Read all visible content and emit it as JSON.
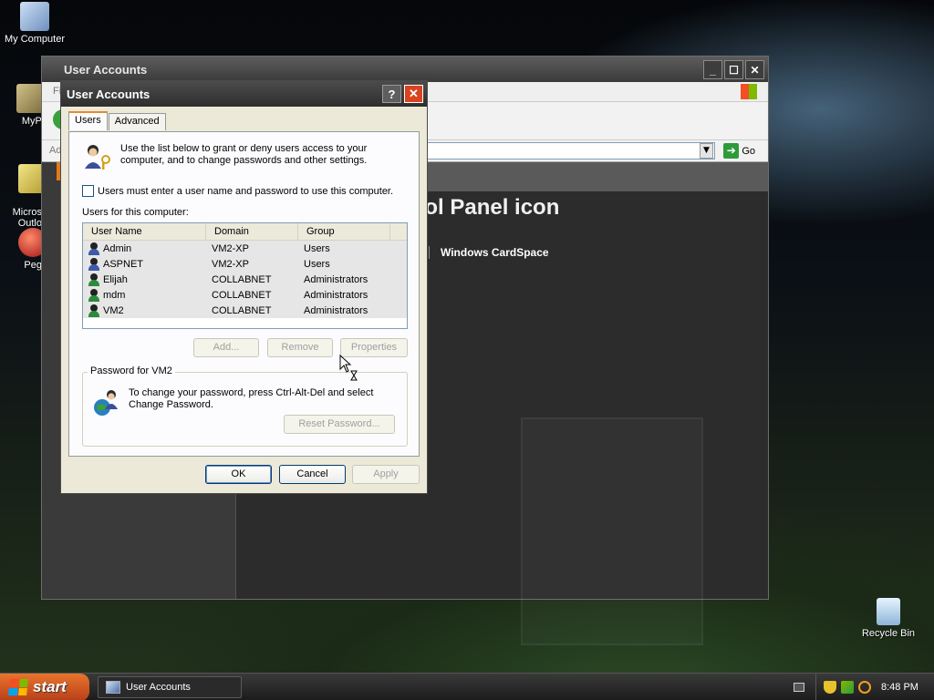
{
  "desktop": {
    "icons": [
      {
        "label": "My Computer"
      },
      {
        "label": "MyPa"
      },
      {
        "label": "Micros\nOutlo"
      },
      {
        "label": "Peg"
      },
      {
        "label": "Recycle Bin"
      }
    ]
  },
  "explorer": {
    "title": "User Accounts",
    "menu_partial": "Fi",
    "address_partial": "Ad",
    "go_label": "Go",
    "heading_partial": "rol Panel icon",
    "cardspace_label": "Windows CardSpace"
  },
  "dialog": {
    "title": "User Accounts",
    "help_label": "?",
    "close_label": "✕",
    "tabs": [
      {
        "label": "Users",
        "active": true
      },
      {
        "label": "Advanced",
        "active": false
      }
    ],
    "intro_text": "Use the list below to grant or deny users access to your computer, and to change passwords and other settings.",
    "require_login_label": "Users must enter a user name and password to use this computer.",
    "require_login_checked": false,
    "users_label": "Users for this computer:",
    "columns": [
      "User Name",
      "Domain",
      "Group"
    ],
    "users": [
      {
        "name": "Admin",
        "domain": "VM2-XP",
        "group": "Users"
      },
      {
        "name": "ASPNET",
        "domain": "VM2-XP",
        "group": "Users"
      },
      {
        "name": "Elijah",
        "domain": "COLLABNET",
        "group": "Administrators"
      },
      {
        "name": "mdm",
        "domain": "COLLABNET",
        "group": "Administrators"
      },
      {
        "name": "VM2",
        "domain": "COLLABNET",
        "group": "Administrators"
      }
    ],
    "add_label": "Add...",
    "remove_label": "Remove",
    "properties_label": "Properties",
    "password_group_title": "Password for VM2",
    "password_text": "To change your password, press Ctrl-Alt-Del and select Change Password.",
    "reset_password_label": "Reset Password...",
    "ok_label": "OK",
    "cancel_label": "Cancel",
    "apply_label": "Apply"
  },
  "taskbar": {
    "start_label": "start",
    "task_label": "User Accounts",
    "clock": "8:48 PM"
  }
}
